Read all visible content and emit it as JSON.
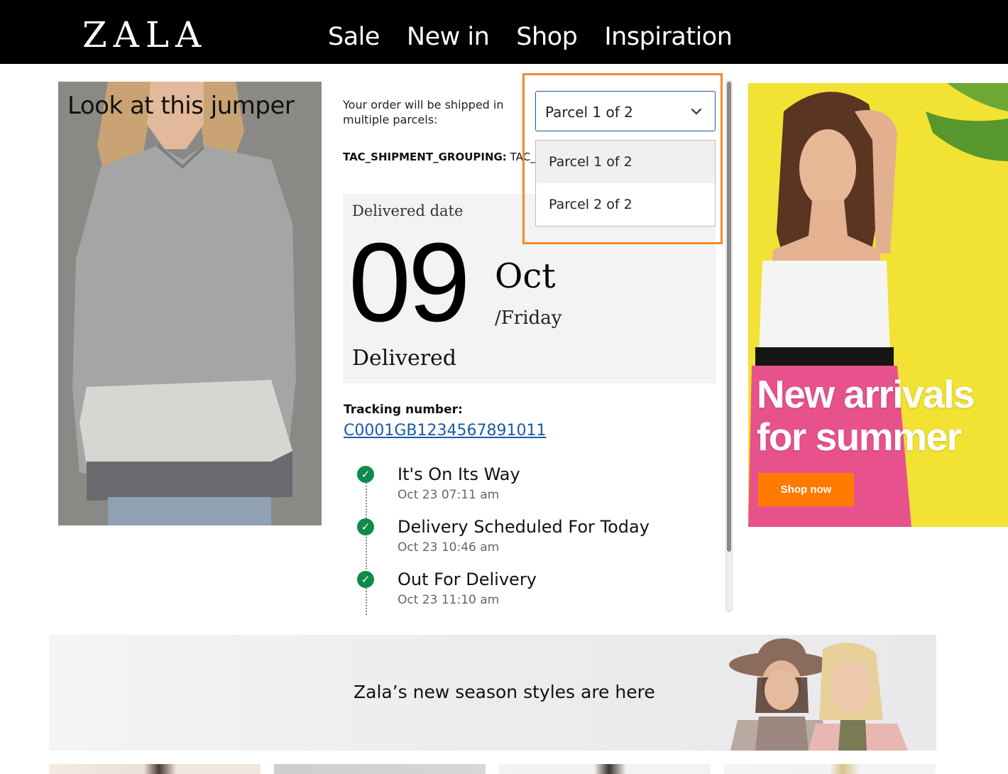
{
  "header": {
    "logo": "ZALA",
    "nav": [
      "Sale",
      "New in",
      "Shop",
      "Inspiration"
    ]
  },
  "left_promo": {
    "caption": "Look at this jumper"
  },
  "order": {
    "shipping_note": "Your order will be shipped in multiple parcels:",
    "grouping_label": "TAC_SHIPMENT_GROUPING:",
    "grouping_value": "TAC_G",
    "parcel_select": {
      "selected": "Parcel 1 of 2",
      "options": [
        "Parcel 1 of 2",
        "Parcel 2 of 2"
      ]
    },
    "delivered": {
      "label": "Delivered date",
      "day": "09",
      "month": "Oct",
      "weekday": "/Friday",
      "status": "Delivered"
    },
    "tracking": {
      "label": "Tracking number:",
      "number": "C0001GB1234567891011"
    },
    "events": [
      {
        "title": "It's On Its Way",
        "time": "Oct 23 07:11 am"
      },
      {
        "title": "Delivery Scheduled For Today",
        "time": "Oct 23 10:46 am"
      },
      {
        "title": "Out For Delivery",
        "time": "Oct 23 11:10 am"
      }
    ]
  },
  "right_promo": {
    "headline": "New arrivals for summer",
    "button": "Shop now"
  },
  "banner": {
    "text": "Zala’s new season styles are here"
  },
  "colors": {
    "header_bg": "#000000",
    "highlight": "#f28a2e",
    "link": "#1a5aa6",
    "check": "#0f8a4b",
    "promo_yellow": "#f1e233",
    "promo_button": "#ff7a00"
  }
}
